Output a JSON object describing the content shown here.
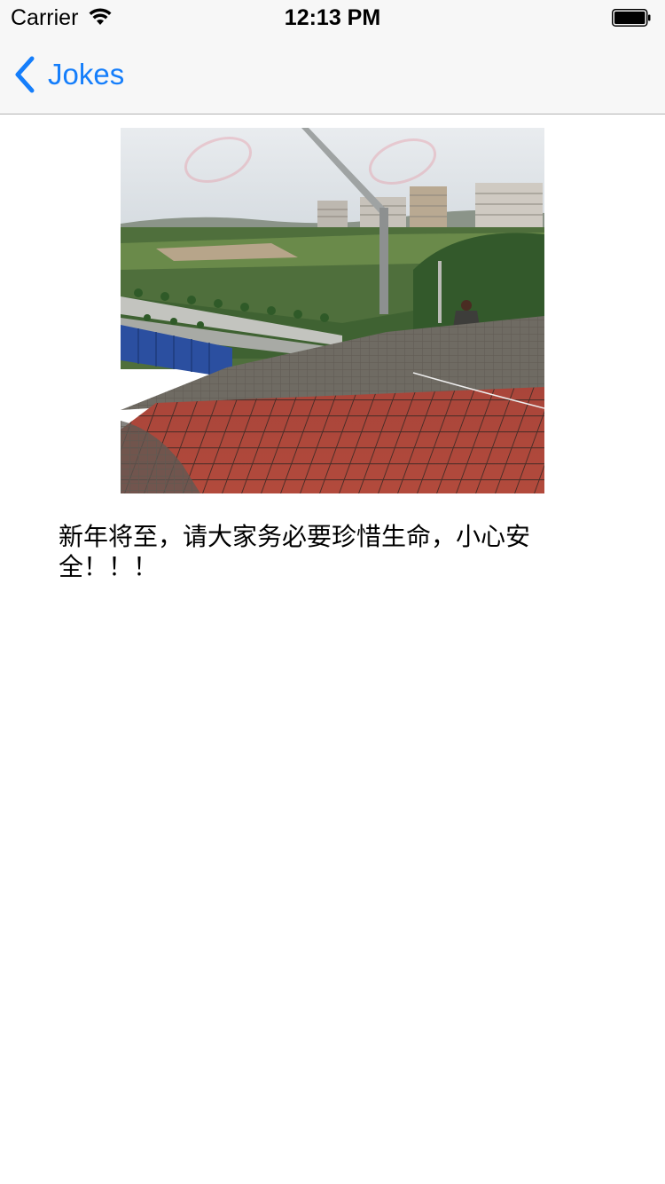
{
  "status_bar": {
    "carrier": "Carrier",
    "time": "12:13 PM",
    "wifi_icon": "wifi-icon",
    "battery_icon": "battery-icon"
  },
  "nav": {
    "back_label": "Jokes",
    "back_icon": "chevron-left-icon",
    "tint_color": "#157efb"
  },
  "joke": {
    "image_description": "construction-site-rooftop-photo",
    "text": "新年将至，请大家务必要珍惜生命，小心安全！！！"
  }
}
